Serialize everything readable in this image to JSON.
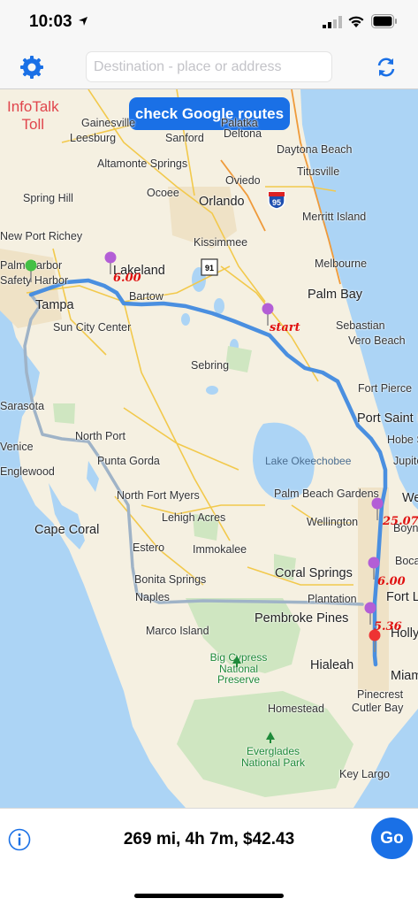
{
  "status_bar": {
    "time": "10:03"
  },
  "nav": {
    "search_placeholder": "Destination - place or address"
  },
  "map": {
    "logo_line1": "InfoTalk",
    "logo_line2": "Toll",
    "check_button": "check Google routes",
    "places": {
      "gainesville": "Gainesville",
      "palatka": "Palatka",
      "leesburg": "Leesburg",
      "sanford": "Sanford",
      "deltona": "Deltona",
      "altamonte": "Altamonte Springs",
      "daytona": "Daytona Beach",
      "spring_hill": "Spring Hill",
      "ocoee": "Ocoee",
      "oviedo": "Oviedo",
      "titusville": "Titusville",
      "orlando": "Orlando",
      "merritt": "Merritt Island",
      "new_port_richey": "New Port Richey",
      "kissimmee": "Kissimmee",
      "palm_harbor": "Palm Harbor",
      "lakeland": "Lakeland",
      "melbourne": "Melbourne",
      "safety_harbor": "Safety Harbor",
      "bartow": "Bartow",
      "tampa": "Tampa",
      "palm_bay": "Palm Bay",
      "sun_city": "Sun City Center",
      "sebastian": "Sebastian",
      "vero": "Vero Beach",
      "sebring": "Sebring",
      "fort_pierce": "Fort Pierce",
      "sarasota": "Sarasota",
      "port_st_lucie": "Port Saint Lucie",
      "hobe_sound": "Hobe Sound",
      "north_port": "North Port",
      "venice": "Venice",
      "punta_gorda": "Punta Gorda",
      "jupiter": "Jupiter",
      "englewood": "Englewood",
      "west_palm": "West Palm Beach",
      "palm_beach_gardens": "Palm Beach Gardens",
      "north_fort_myers": "North Fort Myers",
      "lehigh": "Lehigh Acres",
      "wellington": "Wellington",
      "cape_coral": "Cape Coral",
      "boynton": "Boynton Beach",
      "estero": "Estero",
      "immokalee": "Immokalee",
      "boca": "Boca Raton",
      "coral_springs": "Coral Springs",
      "bonita": "Bonita Springs",
      "fort_lauderdale": "Fort Lauderdale",
      "naples": "Naples",
      "plantation": "Plantation",
      "pembroke": "Pembroke Pines",
      "hollywood": "Hollywood",
      "marco": "Marco Island",
      "big_cypress": "Big Cypress National Preserve",
      "hialeah": "Hialeah",
      "miami": "Miami",
      "pinecrest": "Pinecrest",
      "cutler_bay": "Cutler Bay",
      "homestead": "Homestead",
      "everglades": "Everglades National Park",
      "key_largo": "Key Largo",
      "lake_okeechobee": "Lake Okeechobee"
    },
    "highway_shields": {
      "i95": "95",
      "fl91": "91"
    },
    "start_label": "start",
    "toll_labels": [
      "6.00",
      "25.07",
      "6.00",
      "5.36"
    ]
  },
  "bottom": {
    "summary": "269 mi, 4h 7m, $42.43",
    "go_label": "Go"
  },
  "colors": {
    "accent": "#1a70e6",
    "route": "#4a8fe0",
    "water": "#acd4f5",
    "land": "#f5f0e1",
    "logo": "#e0454c",
    "toll_label": "#e01010",
    "pin_purple": "#b35ed6",
    "pin_green": "#44c044",
    "pin_red": "#ee3333"
  }
}
